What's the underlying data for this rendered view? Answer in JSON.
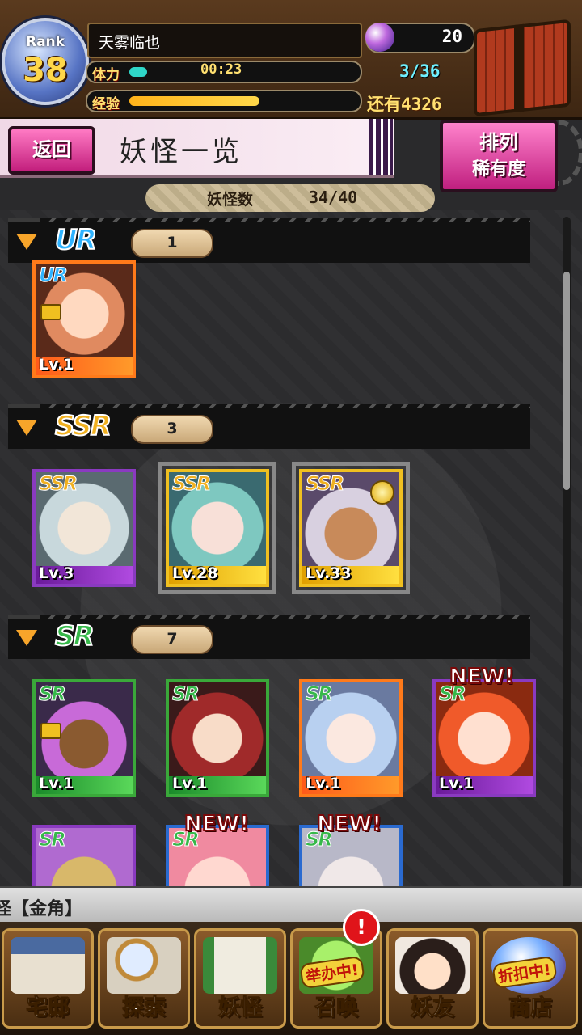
{
  "header": {
    "rank_label": "Rank",
    "rank_value": "38",
    "player_name": "天雾临也",
    "stamina_label": "体力",
    "stamina_timer": "00:23",
    "stamina_fraction": 0.08,
    "exp_label": "经验",
    "exp_fraction": 0.58,
    "gems": "20",
    "stamina_count": "3/36",
    "exp_remaining_label": "还有",
    "exp_remaining_value": "4326"
  },
  "titlebar": {
    "back_label": "返回",
    "title": "妖怪一览",
    "sort_label": "排列",
    "sort_value": "稀有度"
  },
  "yokai_count": {
    "label": "妖怪数",
    "value": "34/40"
  },
  "sections": [
    {
      "rarity": "UR",
      "count": "1",
      "color": "#2fb3ff"
    },
    {
      "rarity": "SSR",
      "count": "3",
      "color": "#f0b020"
    },
    {
      "rarity": "SR",
      "count": "7",
      "color": "#36b84a"
    }
  ],
  "cards": {
    "ur": [
      {
        "rarity": "UR",
        "level": "Lv.1",
        "locked": true
      }
    ],
    "ssr": [
      {
        "rarity": "SSR",
        "level": "Lv.3"
      },
      {
        "rarity": "SSR",
        "level": "Lv.28"
      },
      {
        "rarity": "SSR",
        "level": "Lv.33",
        "medal": true
      }
    ],
    "sr": [
      {
        "rarity": "SR",
        "level": "Lv.1",
        "locked": true
      },
      {
        "rarity": "SR",
        "level": "Lv.1"
      },
      {
        "rarity": "SR",
        "level": "Lv.1"
      },
      {
        "rarity": "SR",
        "level": "Lv.1",
        "badge": "NEW!"
      },
      {
        "rarity": "SR",
        "level": ""
      },
      {
        "rarity": "SR",
        "level": "",
        "badge": "NEW!"
      },
      {
        "rarity": "SR",
        "level": "",
        "badge": "NEW!"
      }
    ]
  },
  "ticker": {
    "text": "怪【金角】"
  },
  "bottom_nav": [
    {
      "label": "宅邸",
      "icon": "mansion-icon"
    },
    {
      "label": "探索",
      "icon": "magnifier-map-icon"
    },
    {
      "label": "妖怪",
      "icon": "scroll-icon"
    },
    {
      "label": "召唤",
      "icon": "summon-icon",
      "tag": "举办中!"
    },
    {
      "label": "妖友",
      "icon": "catgirl-icon"
    },
    {
      "label": "商店",
      "icon": "shop-orb-icon",
      "tag": "折扣中!"
    }
  ],
  "alert_badge": "!"
}
